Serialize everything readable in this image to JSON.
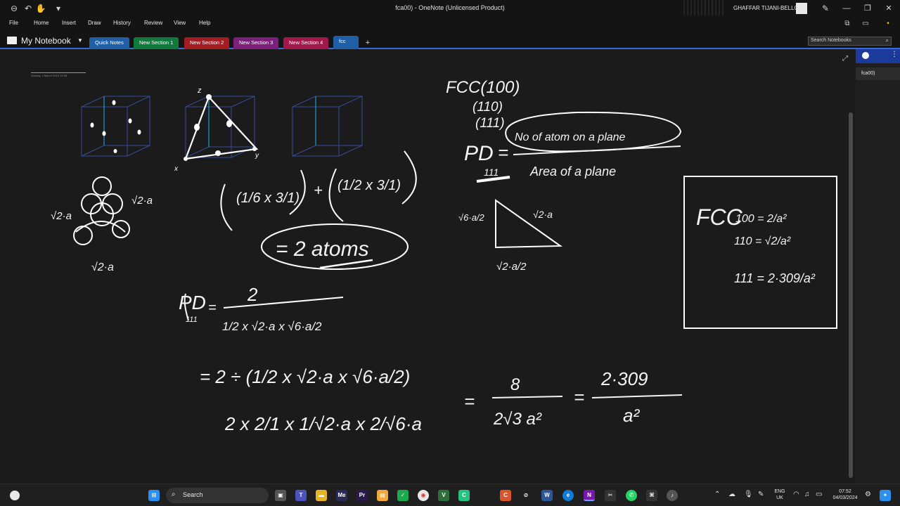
{
  "titlebar": {
    "window_title": "fca00) - OneNote (Unlicensed Product)",
    "user_name": "GHAFFAR TIJANI-BELLO"
  },
  "menu": {
    "items": [
      "File",
      "Home",
      "Insert",
      "Draw",
      "History",
      "Review",
      "View",
      "Help"
    ]
  },
  "notebook": {
    "name": "My Notebook",
    "tabs": [
      {
        "label": "Quick Notes",
        "color": "#1e5fa8"
      },
      {
        "label": "New Section 1",
        "color": "#0f7a3c"
      },
      {
        "label": "New Section 2",
        "color": "#a31d22"
      },
      {
        "label": "New Section 3",
        "color": "#7b1f7a"
      },
      {
        "label": "New Section 4",
        "color": "#a3184a"
      },
      {
        "label": "fcc",
        "color": "#1e5fa8"
      }
    ],
    "active_tab": "fcc",
    "search_placeholder": "Search Notebooks"
  },
  "page": {
    "date_stamp": "Sunday, 3 March 2024     14:58",
    "pages": [
      "fca00)"
    ],
    "handwriting": {
      "fcc_title": "FCC(100)",
      "fcc_110": "(110)",
      "fcc_111": "(111)",
      "pd_label": "PD",
      "pd_sub": "111",
      "pd_numerator": "No of atom on a plane",
      "pd_denominator": "Area of a plane",
      "sqrt2a_left": "√2·a",
      "sqrt2a_right": "√2·a",
      "sqrt2a_bottom": "√2·a",
      "atoms_sum_a": "(1/6 x 3/1)",
      "atoms_sum_b": "(1/2 x 3/1)",
      "atoms_result": "= 2 atoms",
      "tri_left": "√6·a/2",
      "tri_right": "√2·a",
      "tri_bottom": "√2·a/2",
      "pd111_num": "2",
      "pd111_den": "1/2 x √2·a x √6·a/2",
      "step2": "= 2 ÷ (1/2 x √2·a x √6·a/2)",
      "step3": "2 x 2/1 x 1/√2·a x 2/√6·a",
      "step4_num": "8",
      "step4_den": "2√3 a²",
      "step5_num": "2·309",
      "step5_den": "a²",
      "box_fcc": "FCC",
      "box_100": "100 = 2/a²",
      "box_110": "110 = √2/a²",
      "box_111": "111 = 2·309/a²"
    }
  },
  "taskbar": {
    "search_label": "Search",
    "lang_top": "ENG",
    "lang_bottom": "UK",
    "time": "07:52",
    "date": "04/03/2024"
  }
}
